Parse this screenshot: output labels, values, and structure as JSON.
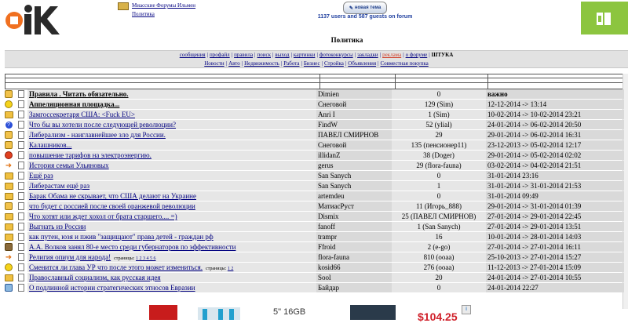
{
  "header": {
    "breadcrumb_forum": "Миасские Форумы Ильмен",
    "breadcrumb_section": "Политика",
    "new_topic_label": "новая тема",
    "online_status": "1137 users and 587 guests on forum"
  },
  "section_title": "Политика",
  "menu_primary": [
    {
      "label": "сообщения",
      "style": "link"
    },
    {
      "label": "профайл",
      "style": "link"
    },
    {
      "label": "правила",
      "style": "link"
    },
    {
      "label": "поиск",
      "style": "link"
    },
    {
      "label": "выход",
      "style": "link"
    },
    {
      "label": "картинки",
      "style": "link"
    },
    {
      "label": "фотоконкурсы",
      "style": "link"
    },
    {
      "label": "закладки",
      "style": "link"
    },
    {
      "label": "реклама",
      "style": "hot"
    },
    {
      "label": "о форуме",
      "style": "link"
    },
    {
      "label": "ШТУКА",
      "style": "bold"
    }
  ],
  "menu_secondary": [
    "Новости",
    "Авто",
    "Недвижимость",
    "Работа",
    "Бизнес",
    "Стройка",
    "Объявления",
    "Совместная покупка"
  ],
  "topics": [
    {
      "icon": "thumb-icon",
      "title": "Правила . Читать обязательно.",
      "bold": true,
      "author": "Dimien",
      "replies": "0",
      "last": "важно"
    },
    {
      "icon": "smile-icon",
      "title": "Аппеляционная площадка...",
      "bold": true,
      "author": "Снеговой",
      "replies": "129 (Sim)",
      "last": "12-12-2014 -> 13:14"
    },
    {
      "icon": "folder-icon",
      "title": "Замгоссекретаря США: <Fuck EU>",
      "bold": false,
      "author": "Anri I",
      "replies": "1 (Sim)",
      "last": "10-02-2014 -> 10-02-2014 23:21"
    },
    {
      "icon": "question-icon",
      "title": "Что бы вы хотели после следующей революции?",
      "bold": false,
      "author": "FindW",
      "replies": "52 (ylial)",
      "last": "24-01-2014 -> 06-02-2014 20:50"
    },
    {
      "icon": "thumb-icon",
      "title": "Либерализм - наиглавнейшее зло для России.",
      "bold": false,
      "author": "ПАВЕЛ СМИРНОВ",
      "replies": "29",
      "last": "29-01-2014 -> 06-02-2014 16:31"
    },
    {
      "icon": "thumb-icon",
      "title": "Калашников...",
      "bold": false,
      "author": "Снеговой",
      "replies": "135 (пенсионер11)",
      "last": "23-12-2013 -> 05-02-2014 12:17"
    },
    {
      "icon": "angry-icon",
      "title": "повышение тарифов на электроэнергию.",
      "bold": false,
      "author": "illidanZ",
      "replies": "38 (Doger)",
      "last": "29-01-2014 -> 05-02-2014 02:02"
    },
    {
      "icon": "arrow-icon",
      "title": "История семьи Ульяновых",
      "bold": false,
      "author": "gerus",
      "replies": "29 (flora-fauna)",
      "last": "03-02-2014 -> 04-02-2014 21:51"
    },
    {
      "icon": "folder-icon",
      "title": "Ещё раз",
      "bold": false,
      "author": "San Sanych",
      "replies": "0",
      "last": "31-01-2014 23:16"
    },
    {
      "icon": "folder-icon",
      "title": "Либерастам ещё раз",
      "bold": false,
      "author": "San Sanych",
      "replies": "1",
      "last": "31-01-2014 -> 31-01-2014 21:53"
    },
    {
      "icon": "folder-icon",
      "title": "Барак Обама не скрывает, что США делают на Украине",
      "bold": false,
      "author": "artemdeu",
      "replies": "0",
      "last": "31-01-2014 09:49"
    },
    {
      "icon": "thumb-icon",
      "title": "что будет с россией после своей оранжевой революции",
      "bold": false,
      "author": "МатиасРуст",
      "replies": "11 (Игорь_888)",
      "last": "29-01-2014 -> 31-01-2014 01:39"
    },
    {
      "icon": "folder-icon",
      "title": "Что хотят или ждет хохол от брата старшего.... =)",
      "bold": false,
      "author": "Dismix",
      "replies": "25 (ПАВЕЛ СМИРНОВ)",
      "last": "27-01-2014 -> 29-01-2014 22:45"
    },
    {
      "icon": "folder-icon",
      "title": "Выгнать из России",
      "bold": false,
      "author": "fanoff",
      "replies": "1 (San Sanych)",
      "last": "27-01-2014 -> 29-01-2014 13:51"
    },
    {
      "icon": "folder-icon",
      "title": "как путен, юзя и пжив \"защищают\" права детей - граждан рф",
      "bold": false,
      "author": "trampr",
      "replies": "16",
      "last": "10-01-2014 -> 28-01-2014 14:03"
    },
    {
      "icon": "mixed-icon",
      "title": "А.А. Волков занял 80-е место среди губернаторов по эффективности",
      "bold": false,
      "author": "Ffroid",
      "replies": "2 (e-go)",
      "last": "27-01-2014 -> 27-01-2014 16:11"
    },
    {
      "icon": "arrow-icon",
      "title": "Религия опиум для народа!",
      "bold": false,
      "pages": "1 2 3 4 5 6",
      "author": "flora-fauna",
      "replies": "810 (ооаа)",
      "last": "25-10-2013 -> 27-01-2014 15:27"
    },
    {
      "icon": "smile-icon",
      "title": "Сменится ли глава УР что после этого может измениться.",
      "bold": false,
      "pages": "1 2",
      "author": "kosid66",
      "replies": "276 (ооаа)",
      "last": "11-12-2013 -> 27-01-2014 15:09"
    },
    {
      "icon": "folder-icon",
      "title": "Православный социализм, как русская идея",
      "bold": false,
      "author": "Sool",
      "replies": "20",
      "last": "24-01-2014 -> 27-01-2014 10:55"
    },
    {
      "icon": "news-icon",
      "title": "О подлинной истории стратегических этносов Евразии",
      "bold": false,
      "author": "Байдар",
      "replies": "0",
      "last": "24-01-2014 22:27"
    }
  ],
  "pages_label": "страницы:",
  "ads": {
    "price": "$104.25",
    "product": "5\" 16GB",
    "info_mark": "i"
  },
  "colors": {
    "link": "#000080",
    "hot": "#d0402a",
    "row_light": "#e6e6e6",
    "row_dark": "#d9d9d9"
  }
}
